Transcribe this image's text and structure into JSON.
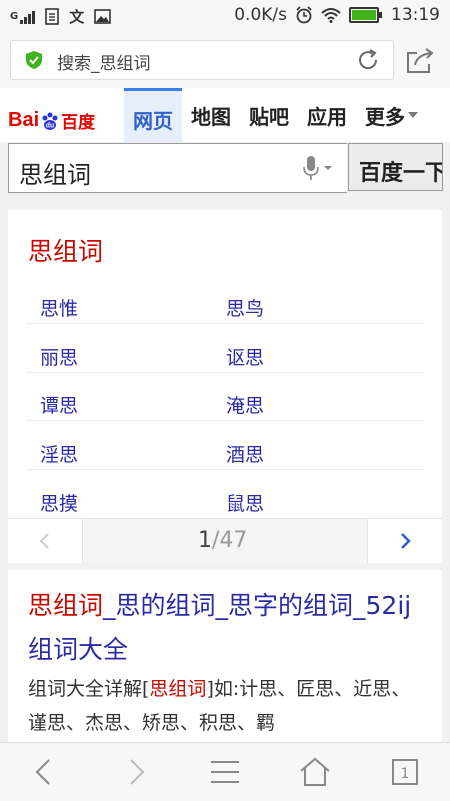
{
  "status_bar": {
    "carrier_icon": "signal-icon",
    "net_speed": "0.0K/s",
    "time": "13:19",
    "battery_color": "#3fb21c"
  },
  "url_bar": {
    "text": "搜索_思组词"
  },
  "baidu": {
    "logo_left": "Bai",
    "logo_right": "百度",
    "tabs": [
      "网页",
      "地图",
      "贴吧",
      "应用",
      "更多"
    ],
    "accent": "#3880f0"
  },
  "search": {
    "query": "思组词",
    "button_label": "百度一下"
  },
  "word_card": {
    "title": "思组词",
    "words": [
      "思惟",
      "思鸟",
      "丽思",
      "讴思",
      "谭思",
      "淹思",
      "淫思",
      "酒思",
      "思摸",
      "鼠思"
    ],
    "page_current": "1",
    "page_total": "/47"
  },
  "result": {
    "title_hl": "思组词",
    "title_rest": "_思的组词_思字的组词_52ij组词大全",
    "desc_prefix": "组词大全详解[",
    "desc_hl": "思组词",
    "desc_rest": "]如:计思、匠思、近思、谨思、杰思、矫思、积思、羁"
  },
  "colors": {
    "red": "#c60a00",
    "link_blue": "#2a2ba4"
  }
}
